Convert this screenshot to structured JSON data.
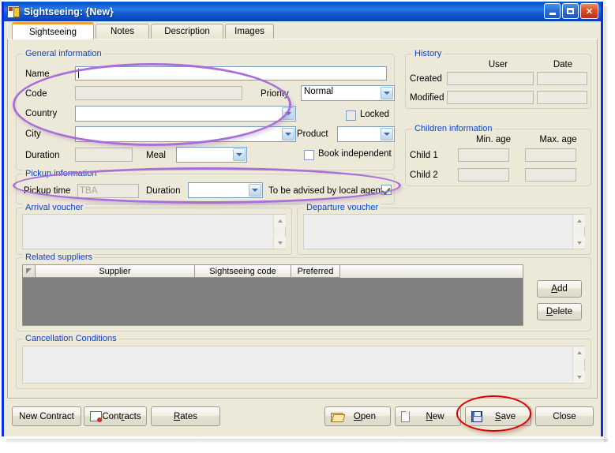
{
  "window": {
    "title": "Sightseeing: {New}",
    "icon": "app-icon",
    "buttons": {
      "minimize": "_",
      "maximize": "□",
      "close": "✕"
    }
  },
  "tabs": [
    {
      "label": "Sightseeing",
      "active": true
    },
    {
      "label": "Notes",
      "active": false
    },
    {
      "label": "Description",
      "active": false
    },
    {
      "label": "Images",
      "active": false
    }
  ],
  "general": {
    "title": "General information",
    "name_label": "Name",
    "name_value": "",
    "code_label": "Code",
    "code_value": "",
    "country_label": "Country",
    "country_value": "",
    "city_label": "City",
    "city_value": "",
    "duration_label": "Duration",
    "duration_value": "",
    "meal_label": "Meal",
    "meal_value": "",
    "priority_label": "Priority",
    "priority_value": "Normal",
    "locked_label": "Locked",
    "locked_checked": false,
    "product_label": "Product",
    "product_value": "",
    "book_independent_label": "Book independent",
    "book_independent_checked": false
  },
  "history": {
    "title": "History",
    "col_user": "User",
    "col_date": "Date",
    "rows": [
      {
        "label": "Created",
        "user": "",
        "date": ""
      },
      {
        "label": "Modified",
        "user": "",
        "date": ""
      }
    ]
  },
  "children": {
    "title": "Children information",
    "col_min": "Min. age",
    "col_max": "Max. age",
    "rows": [
      {
        "label": "Child 1",
        "min": "",
        "max": ""
      },
      {
        "label": "Child 2",
        "min": "",
        "max": ""
      }
    ]
  },
  "pickup": {
    "title": "Pickup information",
    "time_label": "Pickup time",
    "time_placeholder": "TBA",
    "time_value": "",
    "duration_label": "Duration",
    "duration_value": "",
    "advised_label": "To be advised by local agent",
    "advised_checked": true
  },
  "vouchers": {
    "arrival_title": "Arrival voucher",
    "arrival_value": "",
    "departure_title": "Departure voucher",
    "departure_value": ""
  },
  "suppliers": {
    "title": "Related suppliers",
    "columns": [
      "",
      "Supplier",
      "Sightseeing code",
      "Preferred"
    ],
    "rows": [],
    "add_label": "Add",
    "delete_label": "Delete"
  },
  "cancellation": {
    "title": "Cancellation Conditions",
    "value": ""
  },
  "footer": {
    "new_contract": "New Contract",
    "contracts": "Contracts",
    "rates": "Rates",
    "open": "Open",
    "new": "New",
    "save": "Save",
    "close": "Close"
  },
  "annotations": {
    "highlight_color": "#a96fd8",
    "emphasis_color": "#d80000",
    "items": [
      {
        "name": "general-fields-highlight",
        "shape": "ellipse"
      },
      {
        "name": "pickup-section-highlight",
        "shape": "ellipse"
      },
      {
        "name": "save-button-emphasis",
        "shape": "ellipse"
      }
    ]
  }
}
